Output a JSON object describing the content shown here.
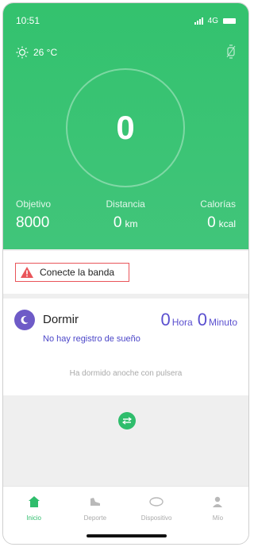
{
  "status_bar": {
    "time": "10:51",
    "network": "4G"
  },
  "weather": {
    "temperature": "26 °C"
  },
  "steps": {
    "count": "0"
  },
  "metrics": [
    {
      "label": "Objetivo",
      "value": "8000",
      "unit": ""
    },
    {
      "label": "Distancia",
      "value": "0",
      "unit": "km"
    },
    {
      "label": "Calorías",
      "value": "0",
      "unit": "kcal"
    }
  ],
  "alert": {
    "text": "Conecte la banda",
    "color": "#e9555a"
  },
  "sleep": {
    "title": "Dormir",
    "hours": "0",
    "hours_unit": "Hora",
    "minutes": "0",
    "minutes_unit": "Minuto",
    "no_record": "No hay registro de sueño",
    "slept_text": "Ha dormido anoche con pulsera"
  },
  "tabs": [
    {
      "label": "Inicio",
      "icon": "home-icon",
      "active": true
    },
    {
      "label": "Deporte",
      "icon": "shoe-icon",
      "active": false
    },
    {
      "label": "Dispositivo",
      "icon": "band-icon",
      "active": false
    },
    {
      "label": "Mío",
      "icon": "person-icon",
      "active": false
    }
  ],
  "colors": {
    "accent": "#2fbd6c",
    "sleep": "#5a4fcf"
  }
}
